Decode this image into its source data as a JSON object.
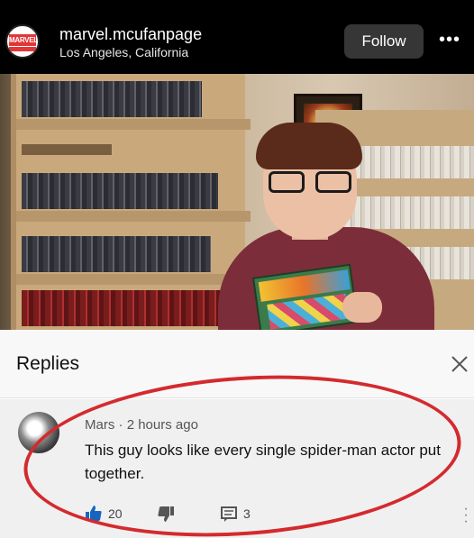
{
  "header": {
    "username": "marvel.mcufanpage",
    "location": "Los Angeles, California",
    "follow_label": "Follow",
    "more_label": "•••",
    "avatar_logo_text": "MARVEL"
  },
  "replies": {
    "title": "Replies",
    "comment": {
      "author": "Mars",
      "time": "2 hours ago",
      "text": "This guy looks like every single spider-man actor put together.",
      "likes": "20",
      "replies": "3"
    }
  },
  "colors": {
    "accent_red": "#d42a2e",
    "follow_button": "#363636",
    "marvel_red": "#e23636"
  },
  "icons": [
    "more-icon",
    "close-icon",
    "thumbs-up-icon",
    "thumbs-down-icon",
    "reply-icon",
    "kebab-icon"
  ]
}
